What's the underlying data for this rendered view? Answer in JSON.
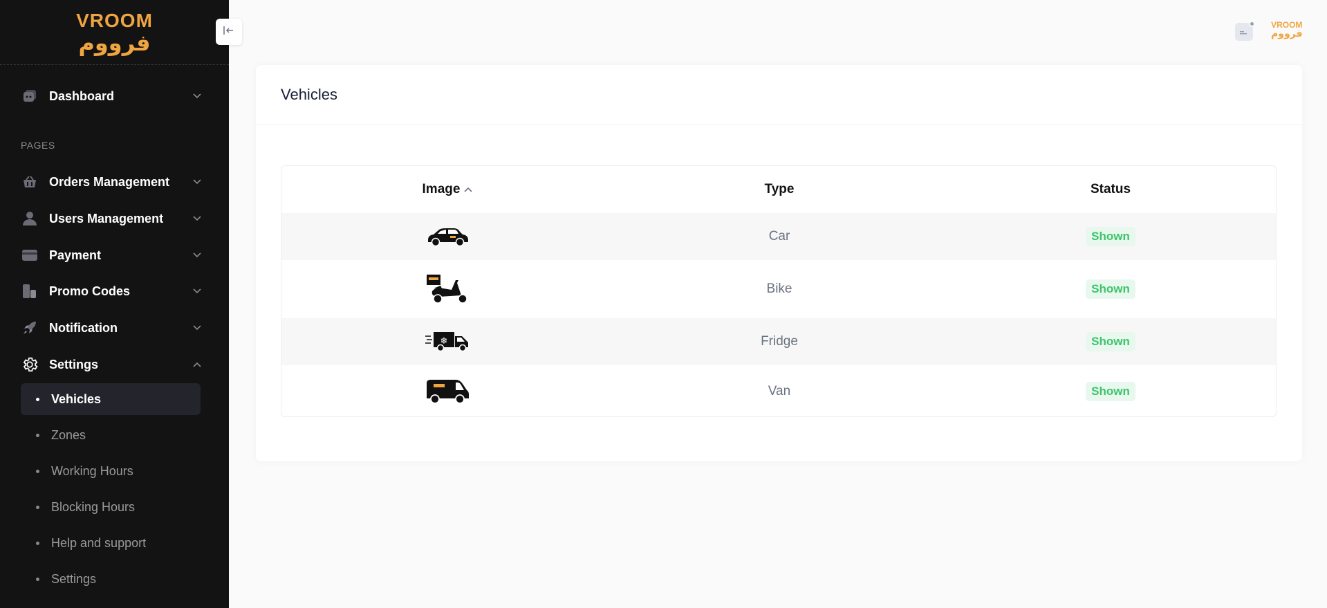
{
  "brand": {
    "name_en": "VROOM",
    "name_ar": "فرووم",
    "color": "#f0a541"
  },
  "sidebar": {
    "dashboard_label": "Dashboard",
    "section_label": "PAGES",
    "items": [
      {
        "label": "Orders Management",
        "icon": "basket-icon"
      },
      {
        "label": "Users Management",
        "icon": "user-icon"
      },
      {
        "label": "Payment",
        "icon": "credit-card-icon"
      },
      {
        "label": "Promo Codes",
        "icon": "promo-icon"
      },
      {
        "label": "Notification",
        "icon": "rocket-icon"
      },
      {
        "label": "Settings",
        "icon": "gear-icon"
      }
    ],
    "settings_sub": [
      {
        "label": "Vehicles",
        "active": true
      },
      {
        "label": "Zones"
      },
      {
        "label": "Working Hours"
      },
      {
        "label": "Blocking Hours"
      },
      {
        "label": "Help and support"
      },
      {
        "label": "Settings"
      }
    ]
  },
  "page": {
    "title": "Vehicles",
    "columns": [
      "Image",
      "Type",
      "Status"
    ],
    "rows": [
      {
        "image": "car-icon",
        "type": "Car",
        "status": "Shown"
      },
      {
        "image": "scooter-icon",
        "type": "Bike",
        "status": "Shown"
      },
      {
        "image": "fridge-truck-icon",
        "type": "Fridge",
        "status": "Shown"
      },
      {
        "image": "van-icon",
        "type": "Van",
        "status": "Shown"
      }
    ],
    "status_color": "#3cc46a"
  }
}
